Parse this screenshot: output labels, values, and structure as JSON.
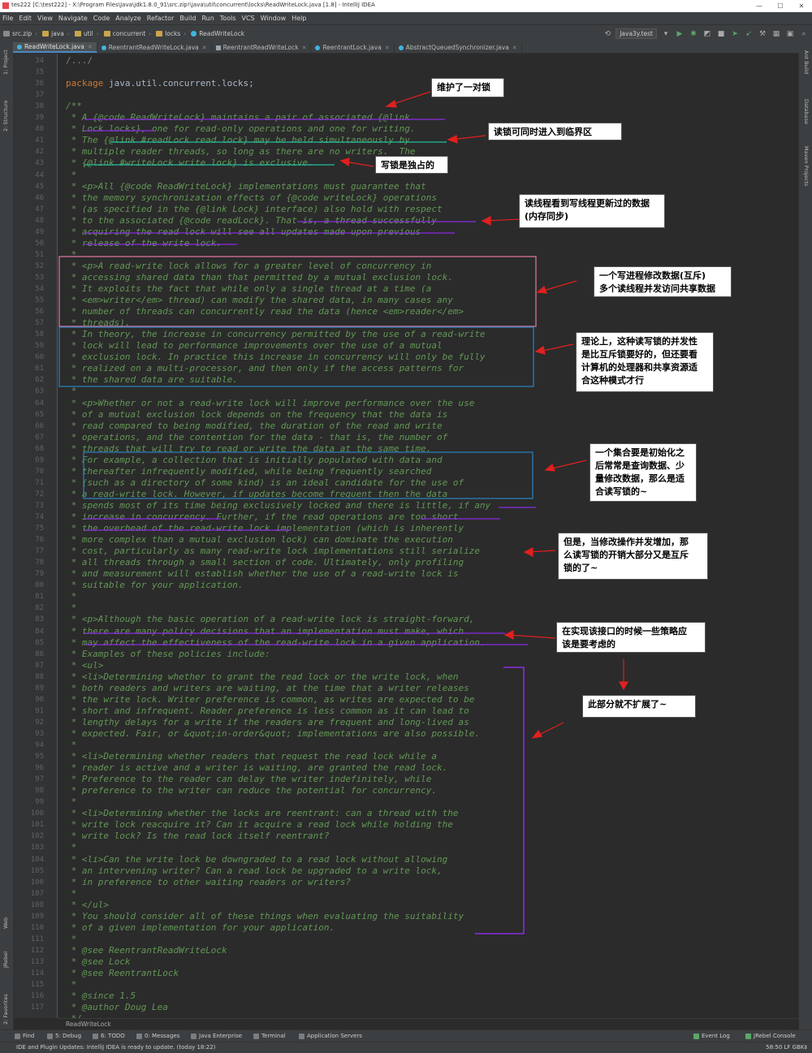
{
  "window": {
    "title": "tes222 [C:\\test222] - X:\\Program Files\\Java\\jdk1.8.0_91\\src.zip!\\java\\util\\concurrent\\locks\\ReadWriteLock.java [1.8] - IntelliJ IDEA",
    "minimize": "—",
    "maximize": "☐",
    "close": "✕"
  },
  "menu": [
    "File",
    "Edit",
    "View",
    "Navigate",
    "Code",
    "Analyze",
    "Refactor",
    "Build",
    "Run",
    "Tools",
    "VCS",
    "Window",
    "Help"
  ],
  "breadcrumbs": [
    "src.zip",
    "java",
    "util",
    "concurrent",
    "locks",
    "ReadWriteLock"
  ],
  "run_config": "Java3y.test",
  "tabs": [
    "ReadWriteLock.java",
    "ReentrantReadWriteLock.java",
    "ReentrantReadWriteLock",
    "ReentrantLock.java",
    "AbstractQueuedSynchronizer.java"
  ],
  "left_tools": [
    "1: Project",
    "2: Structure",
    "Web",
    "JRebel",
    "2: Favorites"
  ],
  "right_tools": [
    "Ant Build",
    "Database",
    "Maven Projects"
  ],
  "code": {
    "lines": [
      {
        "n": "34",
        "t": "/.../",
        "s": "fold"
      },
      {
        "n": "35",
        "t": "",
        "s": ""
      },
      {
        "n": "36",
        "t": "package java.util.concurrent.locks;",
        "s": "package"
      },
      {
        "n": "37",
        "t": "",
        "s": ""
      },
      {
        "n": "38",
        "t": "/**",
        "s": "doc"
      },
      {
        "n": "39",
        "t": " * A {@code ReadWriteLock} maintains a pair of associated {@link",
        "s": "doc"
      },
      {
        "n": "40",
        "t": " * Lock locks}, one for read-only operations and one for writing.",
        "s": "doc"
      },
      {
        "n": "41",
        "t": " * The {@link #readLock read lock} may be held simultaneously by",
        "s": "doc"
      },
      {
        "n": "42",
        "t": " * multiple reader threads, so long as there are no writers.  The",
        "s": "doc"
      },
      {
        "n": "43",
        "t": " * {@link #writeLock write lock} is exclusive.",
        "s": "doc"
      },
      {
        "n": "44",
        "t": " *",
        "s": "doc"
      },
      {
        "n": "45",
        "t": " * <p>All {@code ReadWriteLock} implementations must guarantee that",
        "s": "doc"
      },
      {
        "n": "46",
        "t": " * the memory synchronization effects of {@code writeLock} operations",
        "s": "doc"
      },
      {
        "n": "47",
        "t": " * (as specified in the {@link Lock} interface) also hold with respect",
        "s": "doc"
      },
      {
        "n": "48",
        "t": " * to the associated {@code readLock}. That is, a thread successfully",
        "s": "doc"
      },
      {
        "n": "49",
        "t": " * acquiring the read lock will see all updates made upon previous",
        "s": "doc"
      },
      {
        "n": "50",
        "t": " * release of the write lock.",
        "s": "doc"
      },
      {
        "n": "51",
        "t": " *",
        "s": "doc"
      },
      {
        "n": "52",
        "t": " * <p>A read-write lock allows for a greater level of concurrency in",
        "s": "doc"
      },
      {
        "n": "53",
        "t": " * accessing shared data than that permitted by a mutual exclusion lock.",
        "s": "doc"
      },
      {
        "n": "54",
        "t": " * It exploits the fact that while only a single thread at a time (a",
        "s": "doc"
      },
      {
        "n": "55",
        "t": " * <em>writer</em> thread) can modify the shared data, in many cases any",
        "s": "doc"
      },
      {
        "n": "56",
        "t": " * number of threads can concurrently read the data (hence <em>reader</em>",
        "s": "doc"
      },
      {
        "n": "57",
        "t": " * threads).",
        "s": "doc"
      },
      {
        "n": "58",
        "t": " * In theory, the increase in concurrency permitted by the use of a read-write",
        "s": "doc"
      },
      {
        "n": "59",
        "t": " * lock will lead to performance improvements over the use of a mutual",
        "s": "doc"
      },
      {
        "n": "60",
        "t": " * exclusion lock. In practice this increase in concurrency will only be fully",
        "s": "doc"
      },
      {
        "n": "61",
        "t": " * realized on a multi-processor, and then only if the access patterns for",
        "s": "doc"
      },
      {
        "n": "62",
        "t": " * the shared data are suitable.",
        "s": "doc"
      },
      {
        "n": "63",
        "t": " *",
        "s": "doc"
      },
      {
        "n": "64",
        "t": " * <p>Whether or not a read-write lock will improve performance over the use",
        "s": "doc"
      },
      {
        "n": "65",
        "t": " * of a mutual exclusion lock depends on the frequency that the data is",
        "s": "doc"
      },
      {
        "n": "66",
        "t": " * read compared to being modified, the duration of the read and write",
        "s": "doc"
      },
      {
        "n": "67",
        "t": " * operations, and the contention for the data - that is, the number of",
        "s": "doc"
      },
      {
        "n": "68",
        "t": " * threads that will try to read or write the data at the same time.",
        "s": "doc"
      },
      {
        "n": "69",
        "t": " * For example, a collection that is initially populated with data and",
        "s": "doc"
      },
      {
        "n": "70",
        "t": " * thereafter infrequently modified, while being frequently searched",
        "s": "doc"
      },
      {
        "n": "71",
        "t": " * (such as a directory of some kind) is an ideal candidate for the use of",
        "s": "doc"
      },
      {
        "n": "72",
        "t": " * a read-write lock. However, if updates become frequent then the data",
        "s": "doc"
      },
      {
        "n": "73",
        "t": " * spends most of its time being exclusively locked and there is little, if any",
        "s": "doc"
      },
      {
        "n": "74",
        "t": " * increase in concurrency. Further, if the read operations are too short",
        "s": "doc"
      },
      {
        "n": "75",
        "t": " * the overhead of the read-write lock implementation (which is inherently",
        "s": "doc"
      },
      {
        "n": "76",
        "t": " * more complex than a mutual exclusion lock) can dominate the execution",
        "s": "doc"
      },
      {
        "n": "77",
        "t": " * cost, particularly as many read-write lock implementations still serialize",
        "s": "doc"
      },
      {
        "n": "78",
        "t": " * all threads through a small section of code. Ultimately, only profiling",
        "s": "doc"
      },
      {
        "n": "79",
        "t": " * and measurement will establish whether the use of a read-write lock is",
        "s": "doc"
      },
      {
        "n": "80",
        "t": " * suitable for your application.",
        "s": "doc"
      },
      {
        "n": "81",
        "t": " *",
        "s": "doc"
      },
      {
        "n": "82",
        "t": " *",
        "s": "doc"
      },
      {
        "n": "83",
        "t": " * <p>Although the basic operation of a read-write lock is straight-forward,",
        "s": "doc"
      },
      {
        "n": "84",
        "t": " * there are many policy decisions that an implementation must make, which",
        "s": "doc"
      },
      {
        "n": "85",
        "t": " * may affect the effectiveness of the read-write lock in a given application.",
        "s": "doc"
      },
      {
        "n": "86",
        "t": " * Examples of these policies include:",
        "s": "doc"
      },
      {
        "n": "87",
        "t": " * <ul>",
        "s": "doc"
      },
      {
        "n": "88",
        "t": " * <li>Determining whether to grant the read lock or the write lock, when",
        "s": "doc"
      },
      {
        "n": "89",
        "t": " * both readers and writers are waiting, at the time that a writer releases",
        "s": "doc"
      },
      {
        "n": "90",
        "t": " * the write lock. Writer preference is common, as writes are expected to be",
        "s": "doc"
      },
      {
        "n": "91",
        "t": " * short and infrequent. Reader preference is less common as it can lead to",
        "s": "doc"
      },
      {
        "n": "92",
        "t": " * lengthy delays for a write if the readers are frequent and long-lived as",
        "s": "doc"
      },
      {
        "n": "93",
        "t": " * expected. Fair, or &quot;in-order&quot; implementations are also possible.",
        "s": "doc"
      },
      {
        "n": "94",
        "t": " *",
        "s": "doc"
      },
      {
        "n": "95",
        "t": " * <li>Determining whether readers that request the read lock while a",
        "s": "doc"
      },
      {
        "n": "96",
        "t": " * reader is active and a writer is waiting, are granted the read lock.",
        "s": "doc"
      },
      {
        "n": "97",
        "t": " * Preference to the reader can delay the writer indefinitely, while",
        "s": "doc"
      },
      {
        "n": "98",
        "t": " * preference to the writer can reduce the potential for concurrency.",
        "s": "doc"
      },
      {
        "n": "99",
        "t": " *",
        "s": "doc"
      },
      {
        "n": "100",
        "t": " * <li>Determining whether the locks are reentrant: can a thread with the",
        "s": "doc"
      },
      {
        "n": "101",
        "t": " * write lock reacquire it? Can it acquire a read lock while holding the",
        "s": "doc"
      },
      {
        "n": "102",
        "t": " * write lock? Is the read lock itself reentrant?",
        "s": "doc"
      },
      {
        "n": "103",
        "t": " *",
        "s": "doc"
      },
      {
        "n": "104",
        "t": " * <li>Can the write lock be downgraded to a read lock without allowing",
        "s": "doc"
      },
      {
        "n": "105",
        "t": " * an intervening writer? Can a read lock be upgraded to a write lock,",
        "s": "doc"
      },
      {
        "n": "106",
        "t": " * in preference to other waiting readers or writers?",
        "s": "doc"
      },
      {
        "n": "107",
        "t": " *",
        "s": "doc"
      },
      {
        "n": "108",
        "t": " * </ul>",
        "s": "doc"
      },
      {
        "n": "109",
        "t": " * You should consider all of these things when evaluating the suitability",
        "s": "doc"
      },
      {
        "n": "110",
        "t": " * of a given implementation for your application.",
        "s": "doc"
      },
      {
        "n": "111",
        "t": " *",
        "s": "doc"
      },
      {
        "n": "112",
        "t": " * @see ReentrantReadWriteLock",
        "s": "doc"
      },
      {
        "n": "113",
        "t": " * @see Lock",
        "s": "doc"
      },
      {
        "n": "114",
        "t": " * @see ReentrantLock",
        "s": "doc"
      },
      {
        "n": "115",
        "t": " *",
        "s": "doc"
      },
      {
        "n": "116",
        "t": " * @since 1.5",
        "s": "doc"
      },
      {
        "n": "117",
        "t": " * @author Doug Lea",
        "s": "doc"
      },
      {
        "n": "",
        "t": " */",
        "s": "doc"
      }
    ]
  },
  "notes": [
    "维护了一对锁",
    "读锁可同时进入到临界区",
    "写锁是独占的",
    "读线程看到写线程更新过的数据\n(内存同步)",
    "一个写进程修改数据(互斥)\n多个读线程并发访问共享数据",
    "理论上，这种读写锁的并发性\n是比互斥锁要好的，但还要看\n计算机的处理器和共享资源适\n合这种模式才行",
    "一个集合要是初始化之\n后常常是查询数据、少\n量修改数据，那么是适\n合读写锁的~",
    "但是，当修改操作并发增加，那\n么读写锁的开销大部分又是互斥\n锁的了~",
    "在实现该接口的时候一些策略应\n该是要考虑的",
    "此部分就不扩展了~"
  ],
  "editor_footer": "ReadWriteLock",
  "toolwindows": [
    "Find",
    "5: Debug",
    "6: TODO",
    "0: Messages",
    "Java Enterprise",
    "Terminal",
    "Application Servers",
    "Event Log",
    "JRebel Console"
  ],
  "status": {
    "message": "IDE and Plugin Updates: IntelliJ IDEA is ready to update. (today 18:22)",
    "right": "58:50   LF   GBK‡"
  },
  "colors": {
    "annotation_red": "#e0201e",
    "annotation_purple": "#8a2be2",
    "box_pink": "#e57aa0",
    "box_blue": "#2b83c4",
    "underline_teal": "#20c0a0"
  }
}
